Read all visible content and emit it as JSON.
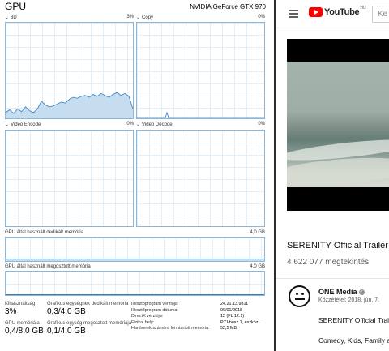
{
  "task_manager": {
    "title": "GPU",
    "gpu_name": "NVIDIA GeForce GTX 970",
    "graphs": {
      "3d": {
        "label": "3D",
        "percent": "3%"
      },
      "copy": {
        "label": "Copy",
        "percent": "0%"
      },
      "video_encode": {
        "label": "Video Encode",
        "percent": "0%"
      },
      "video_decode": {
        "label": "Video Decode",
        "percent": "0%"
      },
      "dedicated": {
        "label": "GPU által használt dedikált memória",
        "max": "4,0 GB"
      },
      "shared": {
        "label": "GPU által használt megosztott memória",
        "max": "4,0 GB"
      }
    },
    "usage_3d_history": [
      0.06,
      0.09,
      0.05,
      0.1,
      0.07,
      0.12,
      0.08,
      0.06,
      0.1,
      0.18,
      0.14,
      0.12,
      0.13,
      0.15,
      0.17,
      0.16,
      0.2,
      0.22,
      0.21,
      0.23,
      0.24,
      0.22,
      0.25,
      0.23,
      0.26,
      0.24,
      0.22,
      0.25,
      0.27,
      0.24,
      0.26,
      0.23,
      0.1
    ],
    "stats": {
      "utilization_label": "Kihasználtság",
      "utilization_value": "3%",
      "dedicated_label": "Grafikus egységnek dedikált memória",
      "dedicated_value": "0,3/4,0 GB",
      "gpu_memory_label": "GPU memóriája",
      "gpu_memory_value": "0,4/8,0 GB",
      "shared_label": "Grafikus egység megosztott memóriája",
      "shared_value": "0,1/4,0 GB"
    },
    "info": [
      {
        "key": "Illesztőprogram verziója:",
        "value": "24.21.13.9811"
      },
      {
        "key": "Illesztőprogram dátuma:",
        "value": "06/01/2018"
      },
      {
        "key": "DirectX verziója:",
        "value": "12 (FL 12.1)"
      },
      {
        "key": "Fizikai hely:",
        "value": "PCI-busz 1, eszköz..."
      },
      {
        "key": "Hardverek számára fenntartott memória:",
        "value": "52,5 MB"
      }
    ]
  },
  "youtube": {
    "logo_text": "YouTube",
    "country": "HU",
    "search_placeholder": "Ke",
    "video_title": "SERENITY Official Trailer (2",
    "views": "4 622 077 megtekintés",
    "channel_name": "ONE Media",
    "publish_date": "Közzététel: 2018. jún. 7.",
    "description_title": "SERENITY Official Traile",
    "tags": "Comedy, Kids, Family an"
  },
  "colors": {
    "graph_border": "#8ab8dc",
    "graph_fill": "#c6dcef",
    "graph_line": "#2f7cc0",
    "youtube_red": "#ff0000"
  }
}
